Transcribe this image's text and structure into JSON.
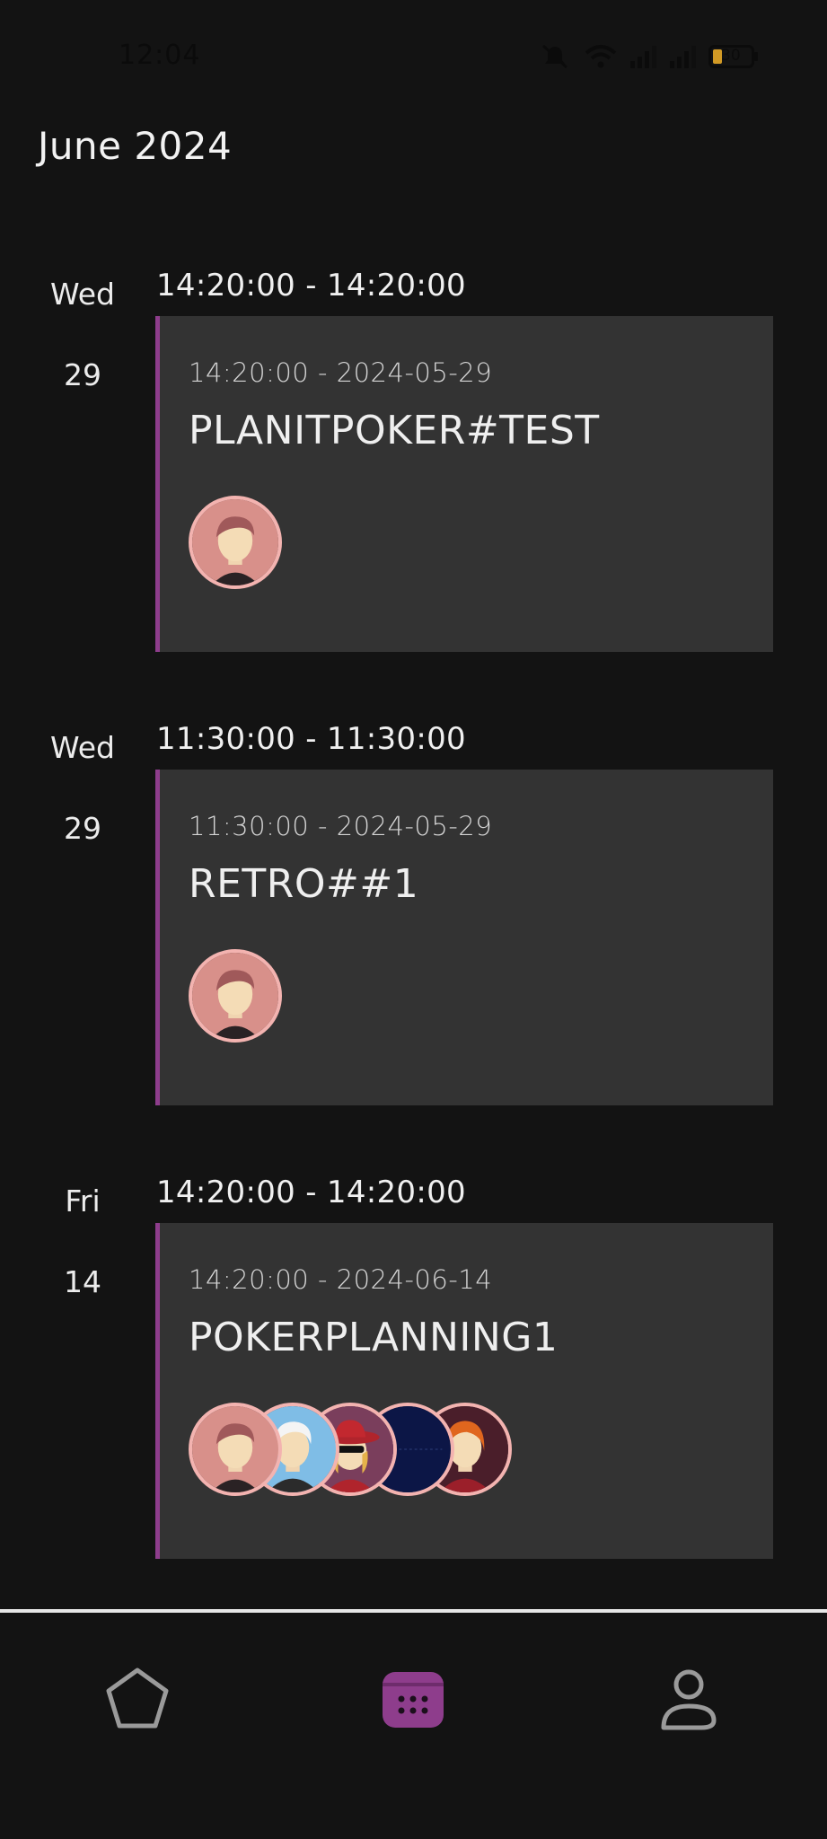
{
  "status_bar": {
    "time": "12:04",
    "battery_level": "30",
    "icons": [
      "mute-icon",
      "wifi-icon",
      "signal-icon",
      "signal-icon",
      "battery-icon"
    ]
  },
  "month_title": "June 2024",
  "colors": {
    "background": "#131313",
    "card": "#333333",
    "accent": "#8e3d8c",
    "avatar_border": "#f3b3b0",
    "nav_active": "#8e3d8c"
  },
  "events": [
    {
      "weekday": "Wed",
      "day": "29",
      "time_range": "14:20:00 - 14:20:00",
      "subtitle": "14:20:00 - 2024-05-29",
      "title": "PLANITPOKER#TEST",
      "participants": [
        "avatar-brown-hair"
      ]
    },
    {
      "weekday": "Wed",
      "day": "29",
      "time_range": "11:30:00 - 11:30:00",
      "subtitle": "11:30:00 - 2024-05-29",
      "title": "RETRO##1",
      "participants": [
        "avatar-brown-hair"
      ]
    },
    {
      "weekday": "Fri",
      "day": "14",
      "time_range": "14:20:00 - 14:20:00",
      "subtitle": "14:20:00 - 2024-06-14",
      "title": "POKERPLANNING1",
      "participants": [
        "avatar-brown-hair",
        "avatar-white-hair",
        "avatar-red-hat",
        "avatar-navy",
        "avatar-ginger"
      ]
    }
  ],
  "bottom_nav": {
    "items": [
      {
        "icon": "pentagon-icon",
        "active": false
      },
      {
        "icon": "calendar-icon",
        "active": true
      },
      {
        "icon": "person-icon",
        "active": false
      }
    ]
  }
}
